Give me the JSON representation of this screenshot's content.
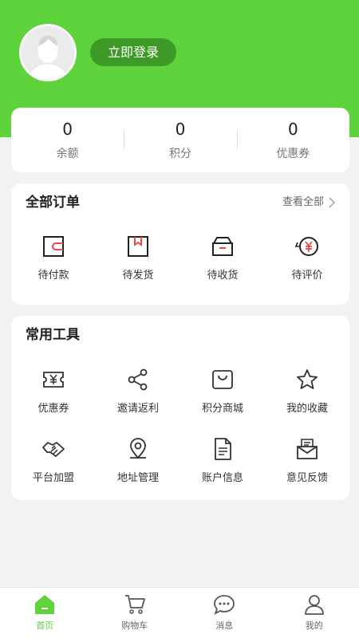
{
  "header": {
    "login_label": "立即登录"
  },
  "stats": [
    {
      "value": "0",
      "label": "余额"
    },
    {
      "value": "0",
      "label": "积分"
    },
    {
      "value": "0",
      "label": "优惠券"
    }
  ],
  "orders": {
    "title": "全部订单",
    "view_all": "查看全部",
    "items": [
      {
        "label": "待付款",
        "icon": "wallet-icon"
      },
      {
        "label": "待发货",
        "icon": "package-icon"
      },
      {
        "label": "待收货",
        "icon": "box-icon"
      },
      {
        "label": "待评价",
        "icon": "yuan-refund-icon"
      }
    ]
  },
  "tools": {
    "title": "常用工具",
    "items": [
      {
        "label": "优惠券",
        "icon": "coupon-icon"
      },
      {
        "label": "邀请返利",
        "icon": "share-icon"
      },
      {
        "label": "积分商城",
        "icon": "shopping-bag-icon"
      },
      {
        "label": "我的收藏",
        "icon": "star-icon"
      },
      {
        "label": "平台加盟",
        "icon": "handshake-icon"
      },
      {
        "label": "地址管理",
        "icon": "location-pin-icon"
      },
      {
        "label": "账户信息",
        "icon": "document-icon"
      },
      {
        "label": "意见反馈",
        "icon": "mail-icon"
      }
    ]
  },
  "tabbar": [
    {
      "label": "首页",
      "icon": "home-icon",
      "active": true
    },
    {
      "label": "购物车",
      "icon": "cart-icon"
    },
    {
      "label": "消息",
      "icon": "chat-icon"
    },
    {
      "label": "我的",
      "icon": "user-icon"
    }
  ],
  "colors": {
    "brand": "#5ed33b",
    "button": "#3e9a26",
    "accent_red": "#e84a4a"
  }
}
